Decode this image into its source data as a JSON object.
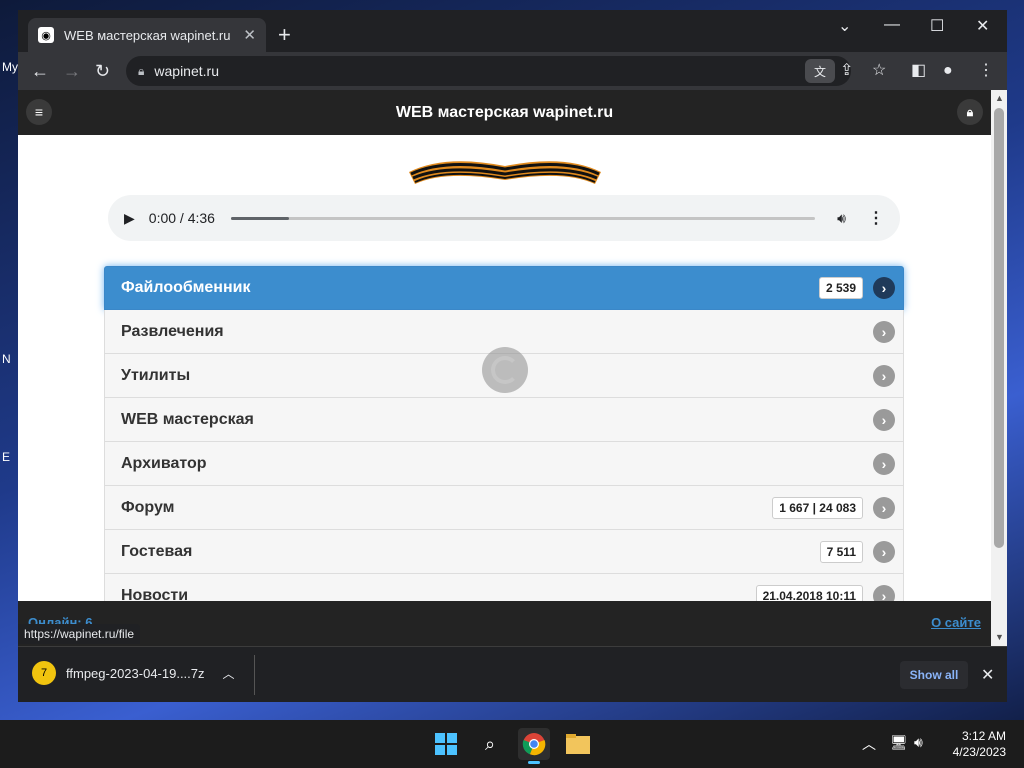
{
  "desktop": {
    "edge_labels": [
      "My",
      "N",
      "E"
    ]
  },
  "browser": {
    "tab": {
      "title": "WEB мастерская wapinet.ru"
    },
    "address": "wapinet.ru",
    "status_url": "https://wapinet.ru/file"
  },
  "site": {
    "title": "WEB мастерская wapinet.ru",
    "audio": {
      "time": "0:00 / 4:36",
      "progress_fraction": 0.1
    },
    "menu": [
      {
        "label": "Файлообменник",
        "count": "2 539",
        "active": true
      },
      {
        "label": "Развлечения",
        "count": ""
      },
      {
        "label": "Утилиты",
        "count": ""
      },
      {
        "label": "WEB мастерская",
        "count": ""
      },
      {
        "label": "Архиватор",
        "count": ""
      },
      {
        "label": "Форум",
        "count": "1 667 | 24 083"
      },
      {
        "label": "Гостевая",
        "count": "7 511"
      },
      {
        "label": "Новости",
        "count": "21.04.2018 10:11"
      }
    ],
    "footer": {
      "online": "Онлайн: 6",
      "about": "О сайте"
    }
  },
  "downloads": {
    "file": "ffmpeg-2023-04-19....7z",
    "show_all": "Show all"
  },
  "taskbar": {
    "time": "3:12 AM",
    "date": "4/23/2023"
  },
  "colors": {
    "accent": "#3c8dce",
    "header": "#232323"
  }
}
